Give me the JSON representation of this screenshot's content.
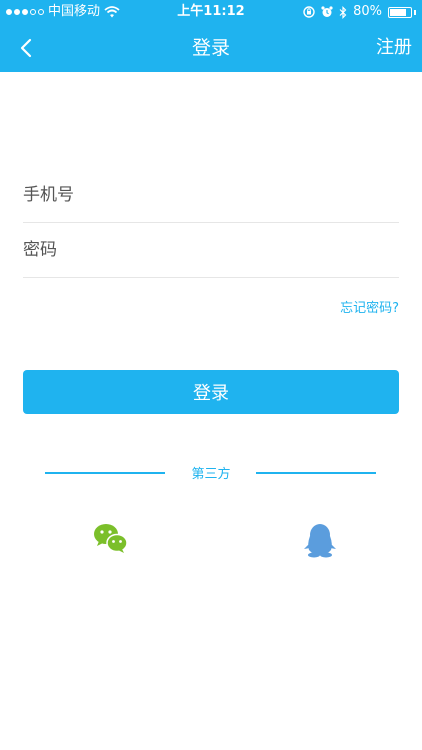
{
  "status_bar": {
    "carrier": "中国移动",
    "time": "上午11:12",
    "battery": "80%",
    "battery_level": 0.8
  },
  "nav": {
    "back_icon": "chevron-left-icon",
    "title": "登录",
    "register_label": "注册"
  },
  "form": {
    "phone_placeholder": "手机号",
    "password_placeholder": "密码",
    "phone_value": "",
    "password_value": "",
    "forgot_label": "忘记密码?",
    "login_label": "登录"
  },
  "third_party": {
    "label": "第三方",
    "providers": [
      {
        "name": "wechat",
        "icon": "wechat-icon",
        "color": "#7bbf2a"
      },
      {
        "name": "qq",
        "icon": "qq-penguin-icon",
        "color": "#5b9ddd"
      }
    ]
  },
  "colors": {
    "accent": "#1fb3ef",
    "wechat": "#7bbf2a",
    "qq": "#5b9ddd"
  }
}
